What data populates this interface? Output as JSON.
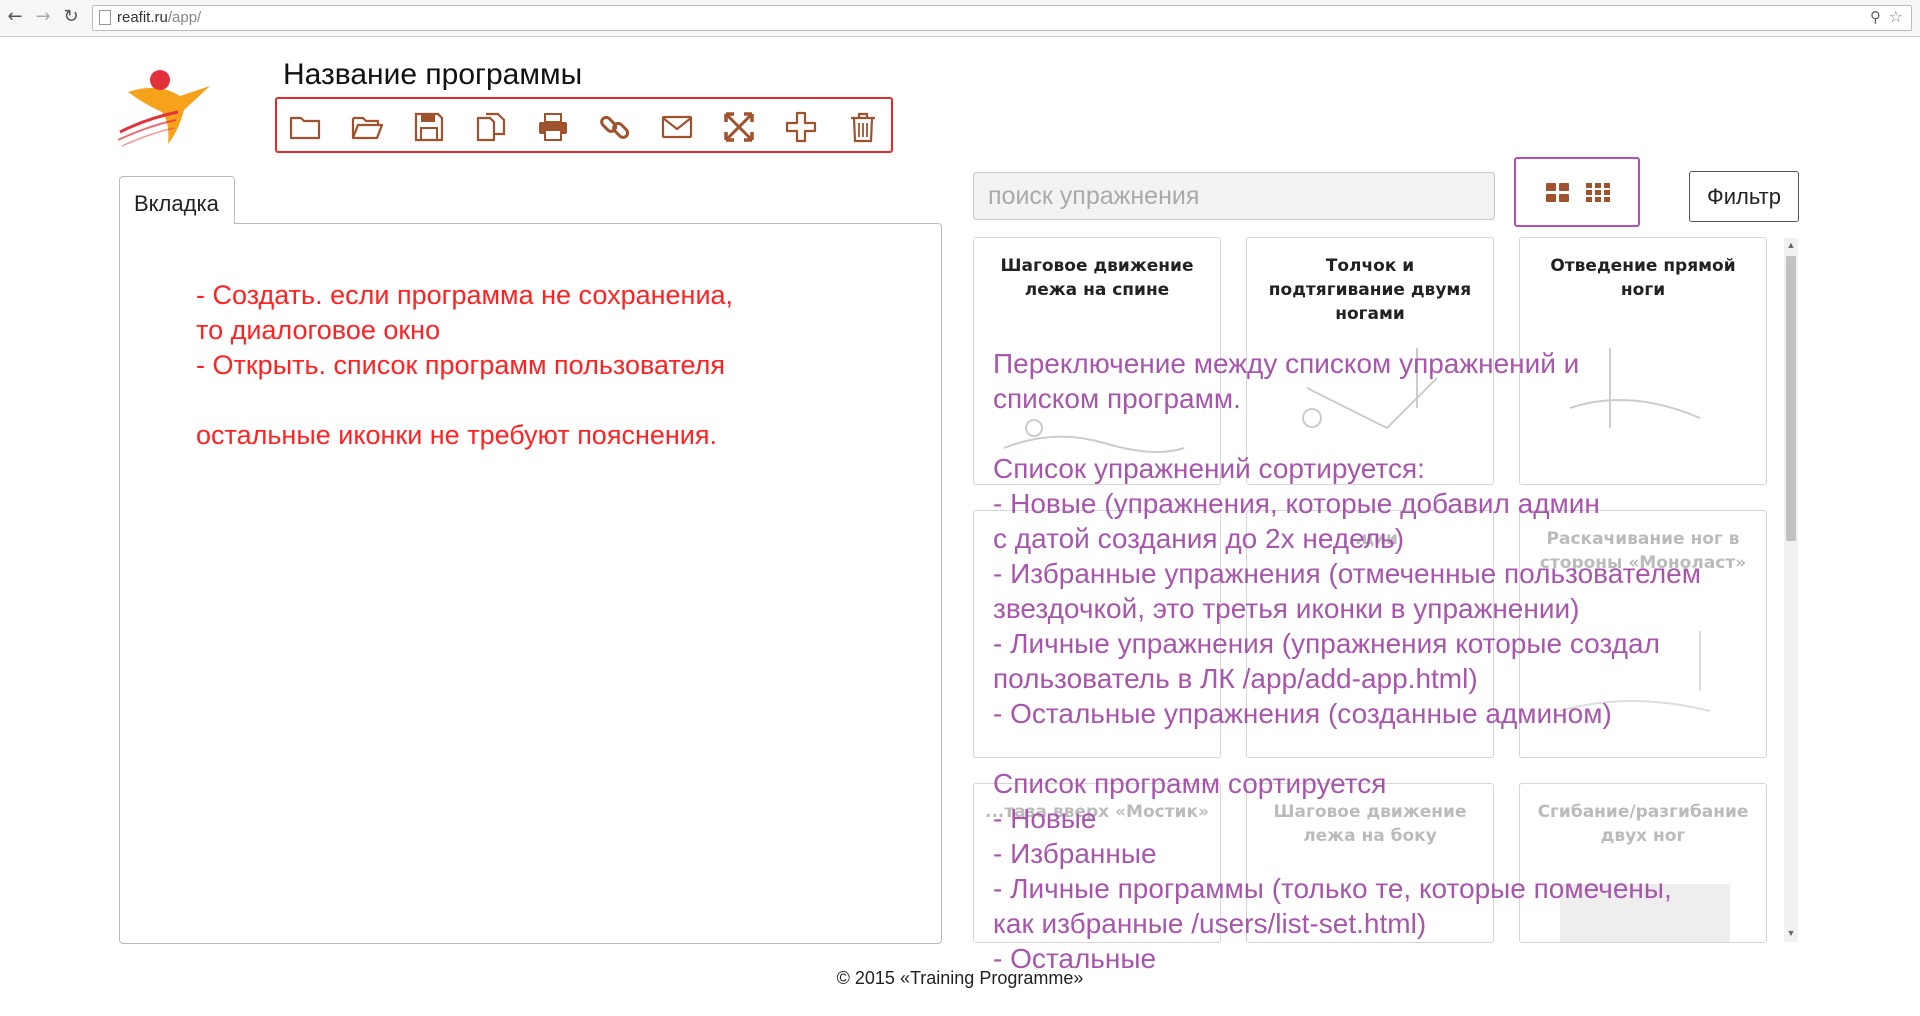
{
  "browser": {
    "url_host": "reafit.ru",
    "url_path": "/app/",
    "back_icon": "back-arrow-icon",
    "forward_icon": "forward-arrow-icon",
    "reload_icon": "reload-icon"
  },
  "header": {
    "program_title": "Название программы"
  },
  "toolbar": {
    "icons": [
      "folder-icon",
      "folder-open-icon",
      "save-icon",
      "copy-icon",
      "print-icon",
      "link-icon",
      "envelope-icon",
      "fullscreen-icon",
      "plus-icon",
      "trash-icon"
    ],
    "color": "#a0522d"
  },
  "tabs": [
    {
      "label": "Вкладка"
    }
  ],
  "left_note": "- Создать. если программа не сохранениа,\nто диалоговое окно\n- Открыть. список программ пользователя\n\nостальные иконки не требуют пояснения.",
  "search": {
    "placeholder": "поиск упражнения"
  },
  "filter": {
    "label": "Фильтр"
  },
  "cards": [
    {
      "title": "Шаговое движение лежа на спине"
    },
    {
      "title": "Толчок и подтягивание двумя ногами"
    },
    {
      "title": "Отведение прямой ноги"
    },
    {
      "title": ""
    },
    {
      "title": "...ции"
    },
    {
      "title": "Раскачивание ног в стороны «Моноласт»"
    },
    {
      "title": "...таза вверх «Мостик»"
    },
    {
      "title": "Шаговое движение лежа на боку"
    },
    {
      "title": "Сгибание/разгибание двух ног"
    }
  ],
  "right_note": "Переключение между списком упражнений и\nсписком программ.\n\nСписок упражнений сортируется:\n- Новые (упражнения, которые добавил админ\nс датой создания до 2х недель)\n- Избранные упражнения (отмеченные пользователем\nзвездочкой, это третья иконки в упражнении)\n- Личные упражнения (упражнения которые создал\nпользователь в ЛК /app/add-app.html)\n- Остальные упражнения (созданные админом)\n\nСписок программ сортируется\n- Новые\n- Избранные\n- Личные программы (только те, которые помечены,\nкак избранные /users/list-set.html)\n- Остальные",
  "footer": {
    "text": "© 2015 «Training Programme»"
  },
  "colors": {
    "red_note": "#ff2222",
    "purple_note": "#a34ea8",
    "toolbar_border": "#e32b2b",
    "toggle_border": "#b64fb8"
  }
}
